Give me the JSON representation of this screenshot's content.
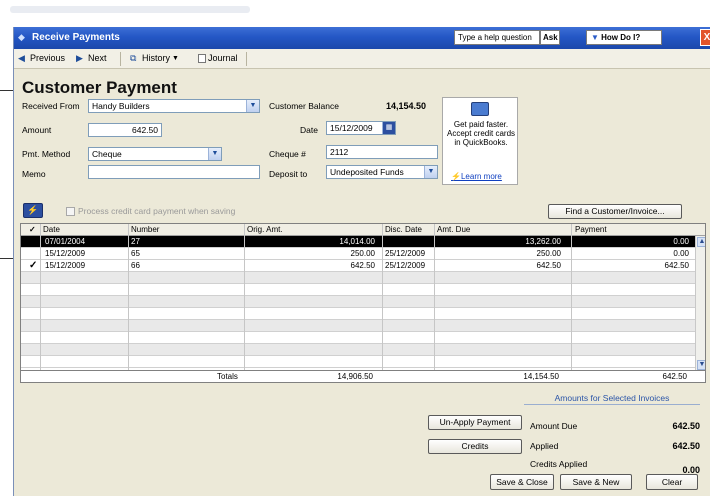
{
  "window": {
    "title": "Receive Payments",
    "help_placeholder": "Type a help question",
    "ask_label": "Ask",
    "how_do_i_label": "How Do I?"
  },
  "toolbar": {
    "previous_label": "Previous",
    "next_label": "Next",
    "history_label": "History",
    "journal_label": "Journal"
  },
  "form": {
    "heading": "Customer Payment",
    "received_from_label": "Received From",
    "received_from_value": "Handy Builders",
    "customer_balance_label": "Customer Balance",
    "customer_balance_value": "14,154.50",
    "amount_label": "Amount",
    "amount_value": "642.50",
    "date_label": "Date",
    "date_value": "15/12/2009",
    "pmt_method_label": "Pmt. Method",
    "pmt_method_value": "Cheque",
    "cheque_label": "Cheque #",
    "cheque_value": "2112",
    "memo_label": "Memo",
    "memo_value": "",
    "deposit_to_label": "Deposit to",
    "deposit_to_value": "Undeposited Funds"
  },
  "ad": {
    "text": "Get paid faster. Accept credit cards in QuickBooks.",
    "link": "Learn more"
  },
  "cc": {
    "process_label": "Process credit card payment when saving",
    "find_button": "Find a Customer/Invoice..."
  },
  "grid": {
    "headers": {
      "check": "✓",
      "date": "Date",
      "number": "Number",
      "orig_amt": "Orig. Amt.",
      "disc_date": "Disc. Date",
      "amt_due": "Amt. Due",
      "payment": "Payment"
    },
    "rows": [
      {
        "check": "",
        "date": "07/01/2004",
        "number": "27",
        "orig_amt": "14,014.00",
        "disc_date": "",
        "amt_due": "13,262.00",
        "payment": "0.00"
      },
      {
        "check": "",
        "date": "15/12/2009",
        "number": "65",
        "orig_amt": "250.00",
        "disc_date": "25/12/2009",
        "amt_due": "250.00",
        "payment": "0.00"
      },
      {
        "check": "✓",
        "date": "15/12/2009",
        "number": "66",
        "orig_amt": "642.50",
        "disc_date": "25/12/2009",
        "amt_due": "642.50",
        "payment": "642.50"
      }
    ],
    "totals": {
      "label": "Totals",
      "orig_amt": "14,906.50",
      "amt_due": "14,154.50",
      "payment": "642.50"
    }
  },
  "summary": {
    "title": "Amounts for Selected Invoices",
    "amount_due_label": "Amount Due",
    "amount_due_value": "642.50",
    "applied_label": "Applied",
    "applied_value": "642.50",
    "credits_applied_label": "Credits Applied",
    "credits_applied_value": "0.00"
  },
  "buttons": {
    "unapply": "Un-Apply Payment",
    "credits": "Credits",
    "save_close": "Save & Close",
    "save_new": "Save & New",
    "clear": "Clear"
  },
  "colors": {
    "title_bar": "#2457c5",
    "selected_row": "#000000",
    "link": "#1040c0"
  }
}
